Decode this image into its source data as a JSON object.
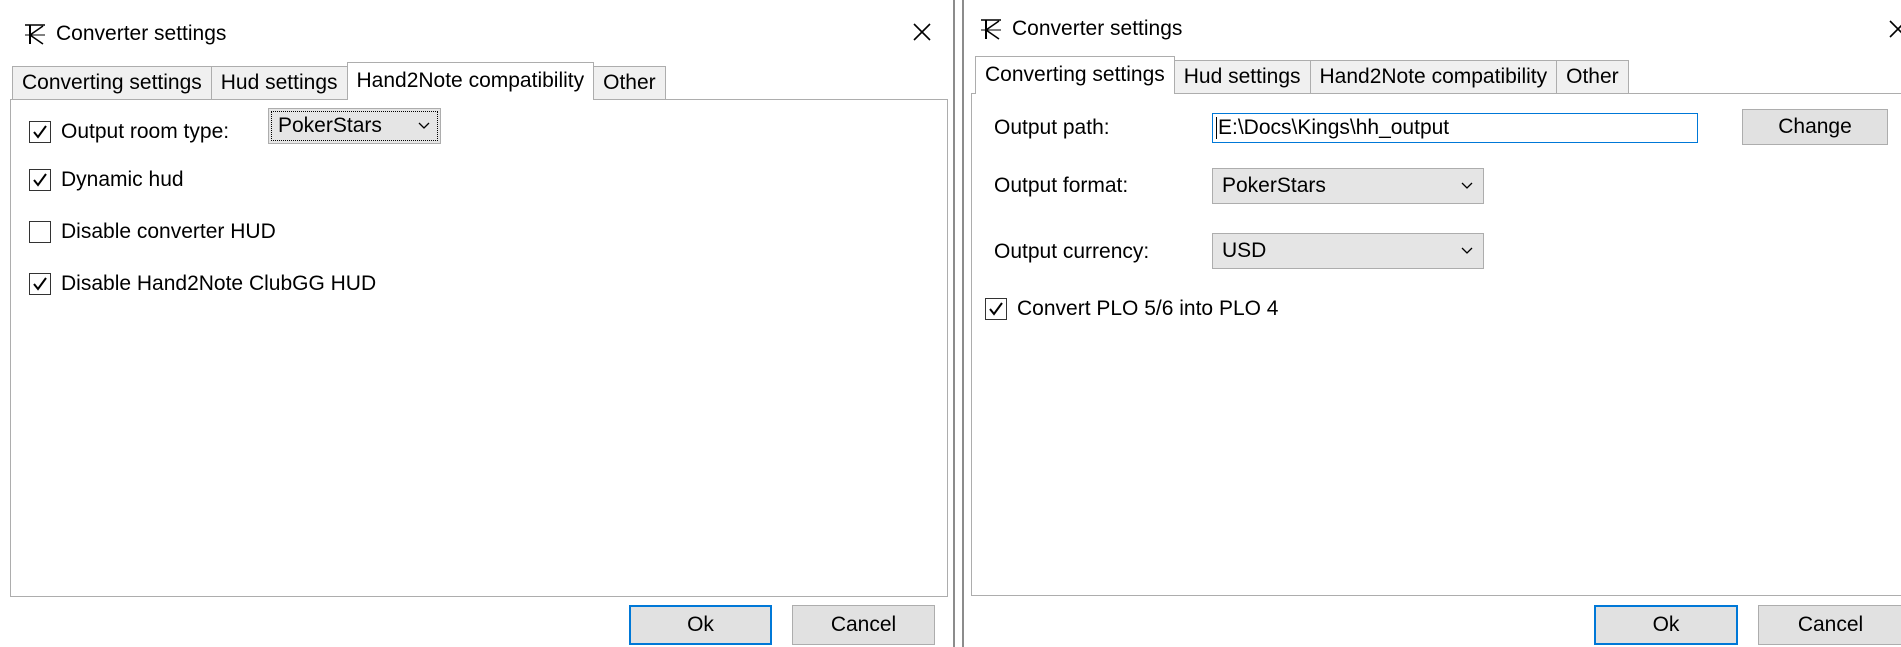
{
  "left_window": {
    "title": "Converter settings",
    "tabs": [
      {
        "label": "Converting settings",
        "active": false
      },
      {
        "label": "Hud settings",
        "active": false
      },
      {
        "label": "Hand2Note compatibility",
        "active": true
      },
      {
        "label": "Other",
        "active": false
      }
    ],
    "output_room_type": {
      "label": "Output room type:",
      "checked": true,
      "value": "PokerStars"
    },
    "options": [
      {
        "label": "Dynamic hud",
        "checked": true
      },
      {
        "label": "Disable converter HUD",
        "checked": false
      },
      {
        "label": "Disable Hand2Note ClubGG HUD",
        "checked": true
      }
    ],
    "buttons": {
      "ok": "Ok",
      "cancel": "Cancel"
    }
  },
  "right_window": {
    "title": "Converter settings",
    "tabs": [
      {
        "label": "Converting settings",
        "active": true
      },
      {
        "label": "Hud settings",
        "active": false
      },
      {
        "label": "Hand2Note compatibility",
        "active": false
      },
      {
        "label": "Other",
        "active": false
      }
    ],
    "output_path": {
      "label": "Output path:",
      "value": "E:\\Docs\\Kings\\hh_output"
    },
    "change_button": "Change",
    "output_format": {
      "label": "Output format:",
      "value": "PokerStars"
    },
    "output_currency": {
      "label": "Output currency:",
      "value": "USD"
    },
    "convert_plo": {
      "label": "Convert PLO 5/6 into PLO 4",
      "checked": true
    },
    "buttons": {
      "ok": "Ok",
      "cancel": "Cancel"
    }
  },
  "colors": {
    "accent": "#0078d7",
    "button_bg": "#e1e1e1",
    "tab_bg": "#f0f0f0",
    "border": "#adadad"
  },
  "icons": {
    "app": "k-logo-icon",
    "close": "close-icon",
    "check": "checkmark-icon",
    "dropdown": "chevron-down-icon"
  }
}
